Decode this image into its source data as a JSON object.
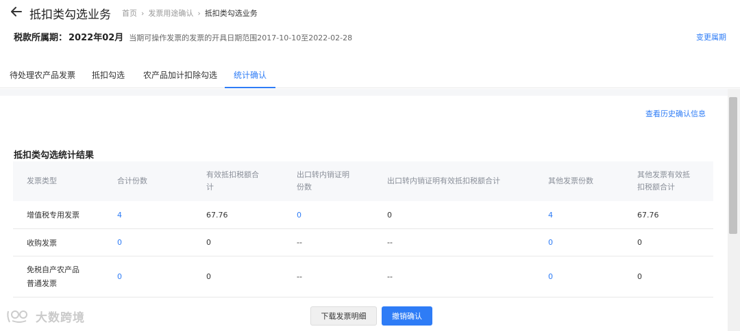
{
  "header": {
    "title": "抵扣类勾选业务",
    "breadcrumb": [
      "首页",
      "发票用途确认",
      "抵扣类勾选业务"
    ]
  },
  "period": {
    "label": "税款所属期：",
    "value": "2022年02月",
    "description": "当期可操作发票的发票的开具日期范围2017-10-10至2022-02-28",
    "change_link": "变更属期"
  },
  "tabs": [
    {
      "label": "待处理农产品发票",
      "active": false
    },
    {
      "label": "抵扣勾选",
      "active": false
    },
    {
      "label": "农产品加计扣除勾选",
      "active": false
    },
    {
      "label": "统计确认",
      "active": true
    }
  ],
  "content": {
    "history_link": "查看历史确认信息",
    "section_title": "抵扣类勾选统计结果"
  },
  "table": {
    "columns": [
      [
        "发票类型"
      ],
      [
        "合计份数"
      ],
      [
        "有效抵扣税额合",
        "计"
      ],
      [
        "出口转内销证明",
        "份数"
      ],
      [
        "出口转内销证明有效抵扣税额合计"
      ],
      [
        "其他发票份数"
      ],
      [
        "其他发票有效抵",
        "扣税额合计"
      ]
    ],
    "rows": [
      {
        "type": [
          "增值税专用发票"
        ],
        "total_count": "4",
        "valid_tax": "67.76",
        "export_count": "0",
        "export_tax": "0",
        "other_count": "4",
        "other_tax": "67.76"
      },
      {
        "type": [
          "收购发票"
        ],
        "total_count": "0",
        "valid_tax": "0",
        "export_count": "--",
        "export_tax": "--",
        "other_count": "0",
        "other_tax": "0"
      },
      {
        "type": [
          "免税自产农产品",
          "普通发票"
        ],
        "total_count": "0",
        "valid_tax": "0",
        "export_count": "--",
        "export_tax": "--",
        "other_count": "0",
        "other_tax": "0"
      }
    ]
  },
  "footer": {
    "download_label": "下载发票明细",
    "cancel_label": "撤销确认"
  },
  "watermark": {
    "text": "大数跨境"
  },
  "colors": {
    "accent": "#2e7cf6",
    "header_bg": "#f7f8fa",
    "border": "#e8e8e8"
  }
}
